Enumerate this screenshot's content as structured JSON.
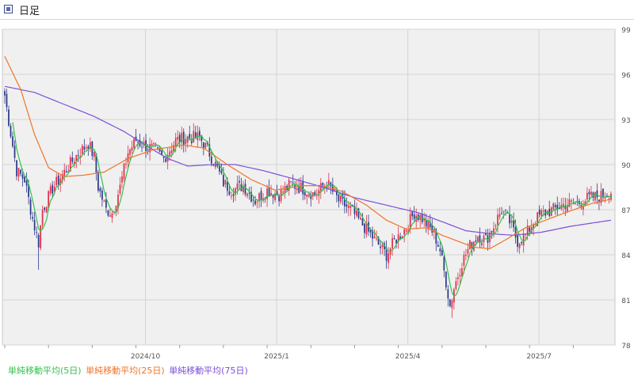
{
  "header": {
    "title": "日足"
  },
  "colors": {
    "up": "#e0304a",
    "down": "#2e3a8c",
    "ma5": "#33c24a",
    "ma25": "#f0742a",
    "ma75": "#7a4fd8",
    "plot_bg": "#f0f0f0",
    "grid": "#d4d4d4",
    "text": "#555555"
  },
  "legend": [
    {
      "label": "単純移動平均(5日)",
      "color": "#33c24a"
    },
    {
      "label": "単純移動平均(25日)",
      "color": "#f0742a"
    },
    {
      "label": "単純移動平均(75日)",
      "color": "#7a4fd8"
    }
  ],
  "chart_data": {
    "type": "candlestick",
    "x_tick_labels": [
      "2024/10",
      "2025/1",
      "2025/4",
      "2025/7"
    ],
    "y_ticks": [
      78,
      81,
      84,
      87,
      90,
      93,
      96,
      99
    ],
    "ylim": [
      78,
      99
    ],
    "grid": true,
    "close_path": [
      [
        0,
        94.6
      ],
      [
        6,
        89.6
      ],
      [
        10,
        89.0
      ],
      [
        14,
        86.4
      ],
      [
        17,
        84.8
      ],
      [
        19,
        87.0
      ],
      [
        24,
        88.4
      ],
      [
        30,
        89.5
      ],
      [
        36,
        90.6
      ],
      [
        42,
        91.4
      ],
      [
        45,
        90.5
      ],
      [
        47,
        88.5
      ],
      [
        51,
        87.0
      ],
      [
        54,
        86.8
      ],
      [
        58,
        88.5
      ],
      [
        62,
        90.8
      ],
      [
        66,
        91.6
      ],
      [
        70,
        91.3
      ],
      [
        75,
        91.0
      ],
      [
        80,
        90.4
      ],
      [
        86,
        91.6
      ],
      [
        92,
        91.8
      ],
      [
        98,
        91.8
      ],
      [
        102,
        91.0
      ],
      [
        106,
        90.0
      ],
      [
        110,
        88.8
      ],
      [
        114,
        88.3
      ],
      [
        120,
        88.6
      ],
      [
        126,
        87.6
      ],
      [
        132,
        88.3
      ],
      [
        138,
        88.0
      ],
      [
        144,
        88.7
      ],
      [
        150,
        88.4
      ],
      [
        156,
        88.0
      ],
      [
        162,
        88.8
      ],
      [
        168,
        87.6
      ],
      [
        174,
        87.0
      ],
      [
        180,
        86.0
      ],
      [
        186,
        85.0
      ],
      [
        192,
        84.0
      ],
      [
        196,
        84.9
      ],
      [
        202,
        85.8
      ],
      [
        206,
        86.8
      ],
      [
        210,
        86.4
      ],
      [
        216,
        85.4
      ],
      [
        219,
        84.3
      ],
      [
        222,
        82.2
      ],
      [
        224,
        80.6
      ],
      [
        226,
        81.8
      ],
      [
        230,
        83.5
      ],
      [
        234,
        84.6
      ],
      [
        238,
        85.3
      ],
      [
        242,
        85.0
      ],
      [
        246,
        85.9
      ],
      [
        250,
        87.0
      ],
      [
        254,
        86.2
      ],
      [
        258,
        84.9
      ],
      [
        262,
        85.3
      ],
      [
        266,
        86.2
      ],
      [
        270,
        86.7
      ],
      [
        276,
        87.0
      ],
      [
        282,
        87.4
      ],
      [
        288,
        87.4
      ],
      [
        294,
        87.8
      ],
      [
        300,
        87.9
      ],
      [
        305,
        88.2
      ]
    ],
    "ma25_path": [
      [
        0,
        97.2
      ],
      [
        8,
        95.0
      ],
      [
        15,
        92.0
      ],
      [
        22,
        89.8
      ],
      [
        30,
        89.2
      ],
      [
        40,
        89.3
      ],
      [
        50,
        89.5
      ],
      [
        62,
        90.4
      ],
      [
        75,
        91.0
      ],
      [
        90,
        91.3
      ],
      [
        100,
        91.1
      ],
      [
        112,
        90.0
      ],
      [
        124,
        89.0
      ],
      [
        136,
        88.3
      ],
      [
        150,
        88.6
      ],
      [
        160,
        88.6
      ],
      [
        170,
        88.2
      ],
      [
        182,
        87.3
      ],
      [
        192,
        86.3
      ],
      [
        202,
        85.7
      ],
      [
        212,
        85.8
      ],
      [
        220,
        85.3
      ],
      [
        228,
        84.9
      ],
      [
        236,
        84.5
      ],
      [
        244,
        84.4
      ],
      [
        252,
        85.0
      ],
      [
        262,
        85.8
      ],
      [
        272,
        86.3
      ],
      [
        282,
        86.8
      ],
      [
        295,
        87.4
      ],
      [
        305,
        87.7
      ]
    ],
    "ma75_path": [
      [
        0,
        95.2
      ],
      [
        15,
        94.8
      ],
      [
        30,
        94.0
      ],
      [
        45,
        93.2
      ],
      [
        60,
        92.2
      ],
      [
        72,
        91.2
      ],
      [
        82,
        90.4
      ],
      [
        92,
        89.9
      ],
      [
        104,
        90.0
      ],
      [
        116,
        90.0
      ],
      [
        130,
        89.6
      ],
      [
        144,
        89.1
      ],
      [
        160,
        88.5
      ],
      [
        176,
        87.8
      ],
      [
        192,
        87.3
      ],
      [
        208,
        86.8
      ],
      [
        220,
        86.2
      ],
      [
        232,
        85.6
      ],
      [
        244,
        85.4
      ],
      [
        256,
        85.3
      ],
      [
        270,
        85.5
      ],
      [
        285,
        85.9
      ],
      [
        305,
        86.3
      ]
    ],
    "series": [
      {
        "name": "単純移動平均(5日)"
      },
      {
        "name": "単純移動平均(25日)"
      },
      {
        "name": "単純移動平均(75日)"
      }
    ]
  }
}
